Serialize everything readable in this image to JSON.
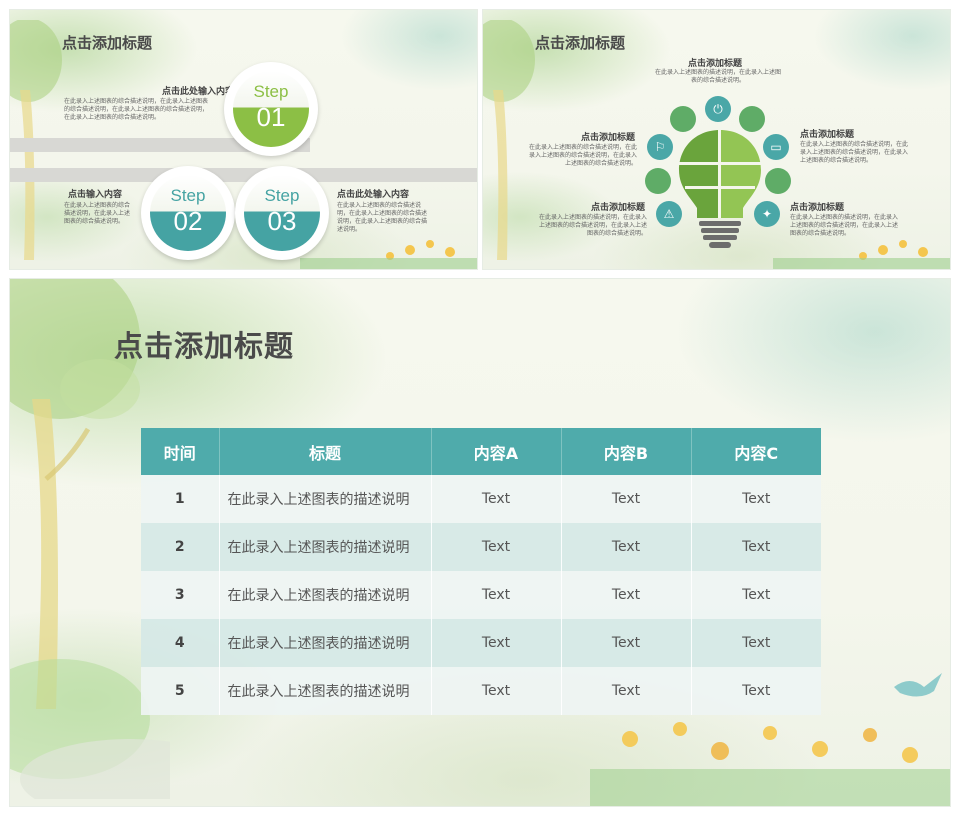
{
  "slides": [
    {
      "title": "点击添加标题",
      "blocks": [
        {
          "heading": "点击此处输入内容",
          "text": "在此录入上述图表的综合描述说明，在此录入上述图表的综合描述说明，在此录入上述图表的综合描述说明，在此录入上述图表的综合描述说明。"
        },
        {
          "heading": "点击输入内容",
          "text": "在此录入上述图表的综合描述说明，在此录入上述图表的综合描述说明。"
        },
        {
          "heading": "点击此处输入内容",
          "text": "在此录入上述图表的综合描述说明，在此录入上述图表的综合描述说明，在此录入上述图表的综合描述说明。"
        }
      ],
      "steps": [
        {
          "word": "Step",
          "num": "01",
          "color": "#8cbf45"
        },
        {
          "word": "Step",
          "num": "02",
          "color": "#45a3a3"
        },
        {
          "word": "Step",
          "num": "03",
          "color": "#45a3a3"
        }
      ]
    },
    {
      "title": "点击添加标题",
      "blocks": [
        {
          "heading": "点击添加标题",
          "text": "在此录入上述图表的描述说明，在此录入上述图表的综合描述说明。"
        },
        {
          "heading": "点击添加标题",
          "text": "在此录入上述图表的综合描述说明，在此录入上述图表的综合描述说明，在此录入上述图表的综合描述说明。"
        },
        {
          "heading": "点击添加标题",
          "text": "在此录入上述图表的综合描述说明，在此录入上述图表的综合描述说明，在此录入上述图表的综合描述说明。"
        },
        {
          "heading": "点击添加标题",
          "text": "在此录入上述图表的描述说明，在此录入上述图表的综合描述说明，在此录入上述图表的综合描述说明。"
        },
        {
          "heading": "点击添加标题",
          "text": "在此录入上述图表的描述说明，在此录入上述图表的综合描述说明，在此录入上述图表的综合描述说明。"
        }
      ],
      "icons": [
        "power-icon",
        "signpost-icon",
        "battery-icon",
        "warning-icon",
        "megaphone-icon"
      ]
    },
    {
      "title": "点击添加标题",
      "table": {
        "headers": [
          "时间",
          "标题",
          "内容A",
          "内容B",
          "内容C"
        ],
        "rows": [
          [
            "1",
            "在此录入上述图表的描述说明",
            "Text",
            "Text",
            "Text"
          ],
          [
            "2",
            "在此录入上述图表的描述说明",
            "Text",
            "Text",
            "Text"
          ],
          [
            "3",
            "在此录入上述图表的描述说明",
            "Text",
            "Text",
            "Text"
          ],
          [
            "4",
            "在此录入上述图表的描述说明",
            "Text",
            "Text",
            "Text"
          ],
          [
            "5",
            "在此录入上述图表的描述说明",
            "Text",
            "Text",
            "Text"
          ]
        ]
      }
    }
  ],
  "colors": {
    "green": "#8cbf45",
    "teal": "#4fabab",
    "bulb_dark": "#6aa43c",
    "bulb_light": "#93c554"
  }
}
